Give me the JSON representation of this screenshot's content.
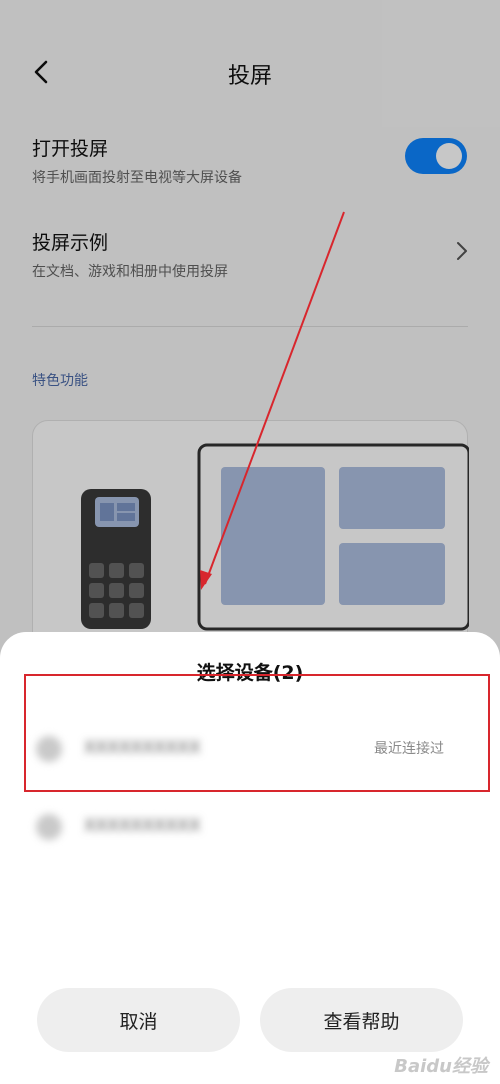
{
  "header": {
    "title": "投屏"
  },
  "settings": {
    "cast": {
      "title": "打开投屏",
      "subtitle": "将手机画面投射至电视等大屏设备",
      "enabled": true
    },
    "example": {
      "title": "投屏示例",
      "subtitle": "在文档、游戏和相册中使用投屏"
    },
    "section_label": "特色功能"
  },
  "sheet": {
    "title": "选择设备(2)",
    "devices": [
      {
        "name": "XXXXXXXXXX",
        "status": "最近连接过"
      },
      {
        "name": "XXXXXXXXXX",
        "status": ""
      }
    ],
    "cancel_label": "取消",
    "help_label": "查看帮助"
  },
  "watermark": "Baidu经验",
  "colors": {
    "accent": "#0d84ff",
    "annotation": "#d8262d"
  }
}
